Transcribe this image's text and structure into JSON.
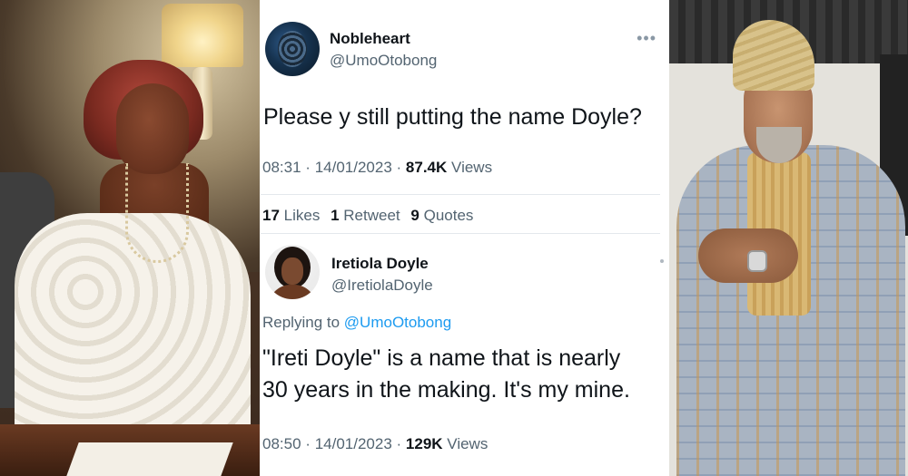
{
  "tweet1": {
    "display_name": "Nobleheart",
    "handle": "@UmoOtobong",
    "more_icon": "•••",
    "text": "Please y still putting the name Doyle?",
    "time": "08:31",
    "sep1": "·",
    "date": "14/01/2023",
    "sep2": "·",
    "views_count": "87.4K",
    "views_label": "Views",
    "stats": {
      "likes_count": "17",
      "likes_label": "Likes",
      "retweets_count": "1",
      "retweets_label": "Retweet",
      "quotes_count": "9",
      "quotes_label": "Quotes"
    }
  },
  "tweet2": {
    "display_name": "Iretiola Doyle",
    "handle": "@IretiolaDoyle",
    "replying_prefix": "Replying to",
    "replying_handle": "@UmoOtobong",
    "text_line1": "\"Ireti Doyle\" is a name that is nearly",
    "text_line2": "30 years in the making. It's my mine.",
    "time": "08:50",
    "sep1": "·",
    "date": "14/01/2023",
    "sep2": "·",
    "views_count": "129K",
    "views_label": "Views"
  },
  "colors": {
    "link": "#1d9bf0",
    "text_primary": "#0f1419",
    "text_secondary": "#536471",
    "divider": "#e4e8ec"
  }
}
